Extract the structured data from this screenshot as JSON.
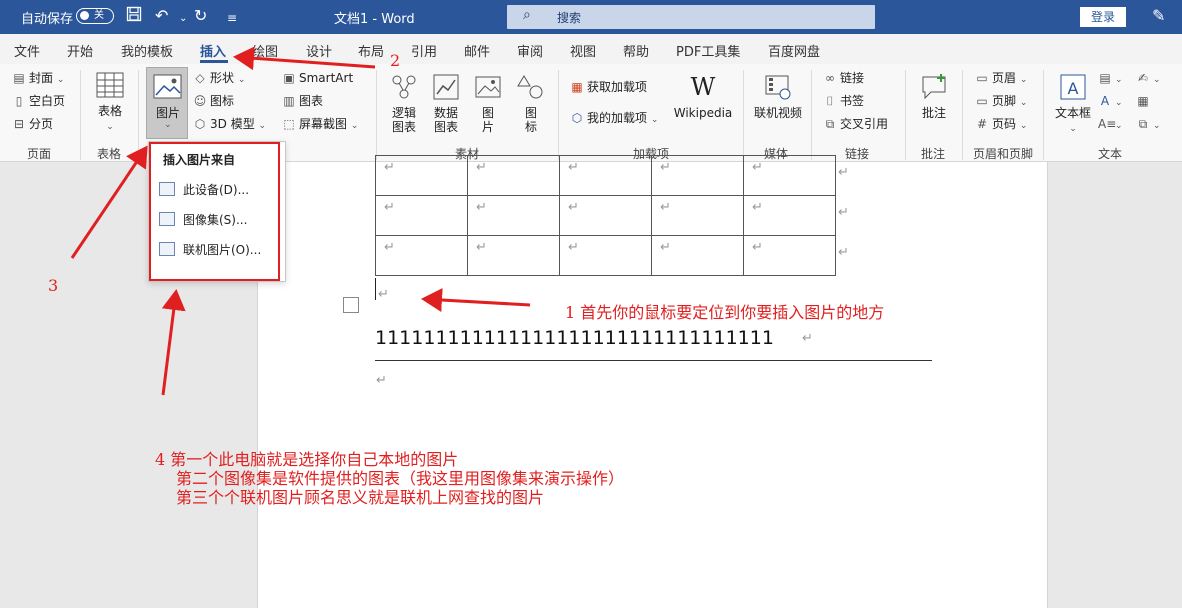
{
  "titlebar": {
    "autosave_label": "自动保存",
    "autosave_state": "关",
    "doc_title": "文档1  -  Word",
    "search_placeholder": "搜索",
    "login_label": "登录"
  },
  "tabs": [
    "文件",
    "开始",
    "我的模板",
    "插入",
    "绘图",
    "设计",
    "布局",
    "引用",
    "邮件",
    "审阅",
    "视图",
    "帮助",
    "PDF工具集",
    "百度网盘"
  ],
  "active_tab": "插入",
  "ribbon": {
    "page_group": {
      "cover": "封面",
      "blank": "空白页",
      "break": "分页",
      "label": "页面"
    },
    "table_group": {
      "button": "表格",
      "label": "表格"
    },
    "illustrations": {
      "picture": "图片",
      "shape": "形状",
      "icon": "图标",
      "model3d": "3D 模型",
      "smartart": "SmartArt",
      "chart": "图表",
      "screenshot": "屏幕截图"
    },
    "materials": {
      "logic": "逻辑图表",
      "data": "数据图表",
      "pic": "图片",
      "ico": "图标",
      "label": "素材"
    },
    "addins": {
      "get": "获取加载项",
      "mine": "我的加载项",
      "wiki": "Wikipedia",
      "label": "加载项"
    },
    "media": {
      "video": "联机视频",
      "label": "媒体"
    },
    "links": {
      "link": "链接",
      "bookmark": "书签",
      "cross": "交叉引用",
      "label": "链接"
    },
    "comments": {
      "comment": "批注",
      "label": "批注"
    },
    "header_footer": {
      "header": "页眉",
      "footer": "页脚",
      "page_no": "页码",
      "label": "页眉和页脚"
    },
    "text": {
      "textbox": "文本框",
      "label": "文本"
    }
  },
  "dropdown": {
    "title": "插入图片来自",
    "items": [
      "此设备(D)...",
      "图像集(S)...",
      "联机图片(O)..."
    ]
  },
  "document": {
    "ones": "111111111111111111111111111111111",
    "para_mark": "↵"
  },
  "annotations": {
    "n1": "1  首先你的鼠标要定位到你要插入图片的地方",
    "n2": "2",
    "n3": "3",
    "n4_line1": "4  第一个此电脑就是选择你自己本地的图片",
    "n4_line2": "第二个图像集是软件提供的图表（我这里用图像集来演示操作）",
    "n4_line3": "第三个个联机图片顾名思义就是联机上网查找的图片"
  },
  "colors": {
    "title_bar": "#2b579a",
    "annotation": "#e02020"
  }
}
